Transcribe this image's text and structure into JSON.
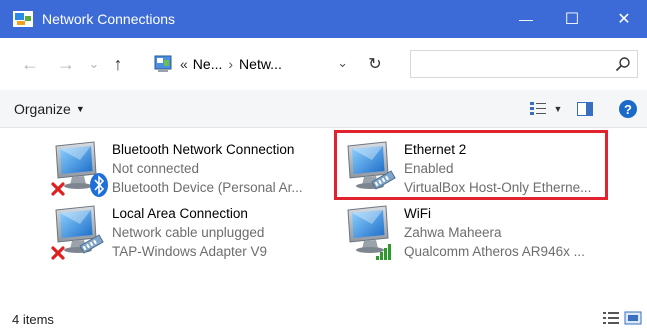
{
  "window": {
    "title": "Network Connections",
    "minimize_glyph": "—",
    "maximize_glyph": "☐",
    "close_glyph": "✕",
    "accent": "#3c6bd7"
  },
  "address": {
    "back_glyph": "←",
    "forward_glyph": "→",
    "dropdown_glyph": "⌄",
    "up_glyph": "↑",
    "overflow": "«",
    "crumb1": "Ne...",
    "separator": "›",
    "crumb2": "Netw...",
    "path_dropdown_glyph": "⌄",
    "refresh_glyph": "↻",
    "search_placeholder": ""
  },
  "command": {
    "organize_label": "Organize",
    "organize_caret": "▼",
    "view_caret": "▼",
    "help_label": "?"
  },
  "connections": [
    {
      "name": "Bluetooth Network Connection",
      "status": "Not connected",
      "device": "Bluetooth Device (Personal Ar...",
      "icon": "bluetooth-adapter-icon",
      "disconnected": true
    },
    {
      "name": "Ethernet 2",
      "status": "Enabled",
      "device": "VirtualBox Host-Only Etherne...",
      "icon": "ethernet-adapter-icon",
      "selected": true
    },
    {
      "name": "Local Area Connection",
      "status": "Network cable unplugged",
      "device": "TAP-Windows Adapter V9",
      "icon": "ethernet-adapter-icon",
      "disconnected": true
    },
    {
      "name": "WiFi",
      "status": "Zahwa Maheera",
      "device": "Qualcomm Atheros AR946x ...",
      "icon": "wifi-adapter-icon"
    }
  ],
  "status": {
    "item_count": "4 items"
  },
  "colors": {
    "selection_outline": "#e0232e",
    "disconnected_x": "#e02020",
    "bluetooth": "#1e6fd9",
    "wifi_signal": "#2e9a2e"
  }
}
